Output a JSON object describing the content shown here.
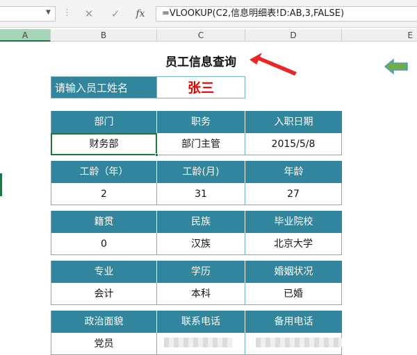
{
  "formula_bar": {
    "cancel_icon": "cancel-x-icon",
    "enter_icon": "check-icon",
    "fx_label": "fx",
    "formula": "=VLOOKUP(C2,信息明细表!D:AB,3,FALSE)"
  },
  "columns": [
    {
      "label": "A"
    },
    {
      "label": "B"
    },
    {
      "label": "C"
    },
    {
      "label": "D"
    },
    {
      "label": "E"
    }
  ],
  "sheet": {
    "title": "员工信息查询",
    "input_label": "请输入员工姓名",
    "input_value": "张三",
    "blocks": [
      {
        "headers": [
          "部门",
          "职务",
          "入职日期"
        ],
        "values": [
          "财务部",
          "部门主管",
          "2015/5/8"
        ]
      },
      {
        "headers": [
          "工龄（年）",
          "工龄(月)",
          "年龄"
        ],
        "values": [
          "2",
          "31",
          "27"
        ]
      },
      {
        "headers": [
          "籍贯",
          "民族",
          "毕业院校"
        ],
        "values": [
          "0",
          "汉族",
          "北京大学"
        ]
      },
      {
        "headers": [
          "专业",
          "学历",
          "婚姻状况"
        ],
        "values": [
          "会计",
          "本科",
          "已婚"
        ]
      },
      {
        "headers": [
          "政治面貌",
          "联系电话",
          "备用电话"
        ],
        "values": [
          "党员",
          "",
          ""
        ]
      }
    ]
  },
  "colors": {
    "header_fill": "#31859c",
    "accent_green": "#217346",
    "name_red": "#e60000",
    "arrow_red": "#e8262a",
    "back_arrow_green": "#70ad47"
  }
}
